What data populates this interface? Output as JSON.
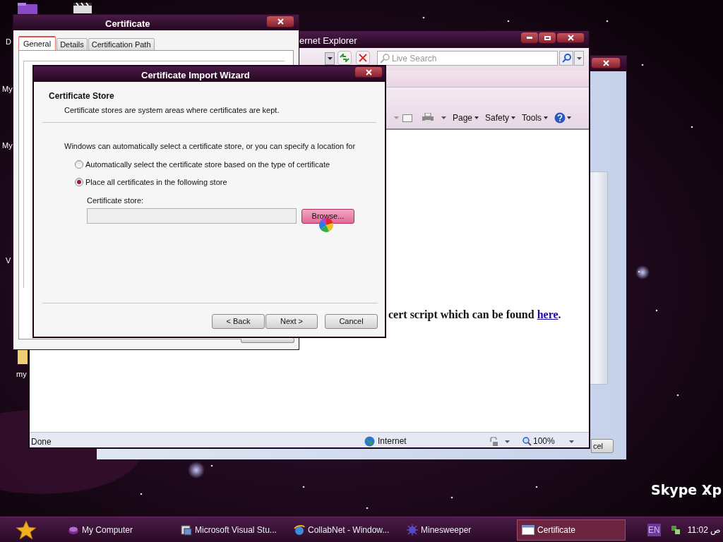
{
  "desktop": {
    "icon_labels": [
      "D",
      "My",
      "My",
      "V",
      "my"
    ],
    "brand_text": "Skype Xp"
  },
  "back_window": {
    "button_text": "cel"
  },
  "browser": {
    "title": "ernet Explorer",
    "search_placeholder": "Live Search",
    "command_menus": [
      "Page",
      "Safety",
      "Tools"
    ],
    "content": {
      "text": "cert script which can be found ",
      "link": "here",
      "after": "."
    },
    "status": "Done",
    "zone": "Internet",
    "zoom": "100%"
  },
  "certificate": {
    "title": "Certificate",
    "tabs": [
      {
        "label": "General",
        "selected": true
      },
      {
        "label": "Details",
        "selected": false
      },
      {
        "label": "Certification Path",
        "selected": false
      }
    ]
  },
  "wizard": {
    "title": "Certificate Import Wizard",
    "heading": "Certificate Store",
    "subheading": "Certificate stores are system areas where certificates are kept.",
    "intro": "Windows can automatically select a certificate store, or you can specify a location for",
    "options": [
      {
        "label": "Automatically select the certificate store based on the type of certificate",
        "selected": false
      },
      {
        "label": "Place all certificates in the following store",
        "selected": true
      }
    ],
    "field_label": "Certificate store:",
    "browse": "Browse...",
    "buttons": [
      "< Back",
      "Next >",
      "Cancel"
    ]
  },
  "taskbar": {
    "items": [
      {
        "label": "My Computer",
        "selected": false
      },
      {
        "label": "Microsoft Visual Stu...",
        "selected": false
      },
      {
        "label": "CollabNet - Window...",
        "selected": false
      },
      {
        "label": "Minesweeper",
        "selected": false
      },
      {
        "label": "Certificate",
        "selected": true
      }
    ],
    "language": "EN",
    "clock": "11:02 ص"
  }
}
